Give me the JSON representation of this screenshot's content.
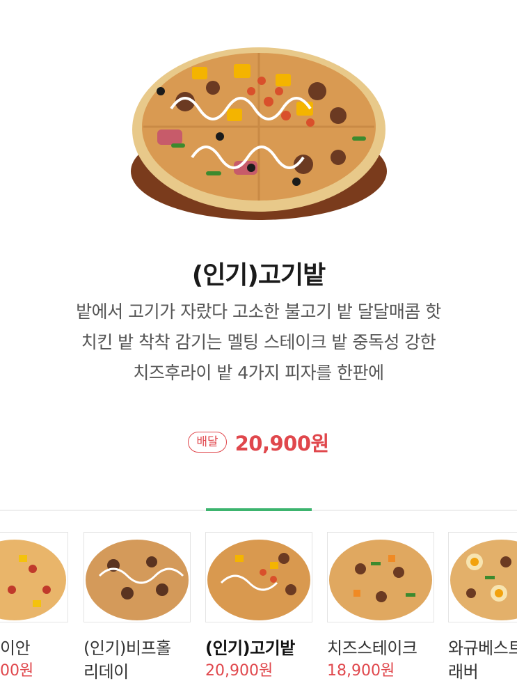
{
  "product": {
    "image_icon": "pizza-image",
    "title": "(인기)고기밭",
    "description_lines": [
      "밭에서 고기가 자랐다 고소한 불고기 밭 달달매콤 핫",
      "치킨 밭 착착 감기는 멜팅 스테이크 밭 중독성 강한",
      "치즈후라이 밭 4가지 피자를 한판에"
    ],
    "badge": "배달",
    "price": "20,900원"
  },
  "colors": {
    "accent_red": "#e0474c",
    "active_green": "#3cb46e"
  },
  "menu_strip": {
    "items": [
      {
        "name": "이안",
        "price": "00원",
        "active": false
      },
      {
        "name": "(인기)비프홀리데이",
        "name_lines": [
          "(인기)비프홀",
          "리데이"
        ],
        "price": "",
        "active": false
      },
      {
        "name": "(인기)고기밭",
        "name_lines": [
          "(인기)고기밭"
        ],
        "price": "20,900원",
        "active": true
      },
      {
        "name": "치즈스테이크",
        "name_lines": [
          "치즈스테이크"
        ],
        "price": "18,900원",
        "active": false
      },
      {
        "name": "와규베스트",
        "name_lines": [
          "와규베스트",
          "래버"
        ],
        "price": "",
        "active": false
      }
    ]
  }
}
